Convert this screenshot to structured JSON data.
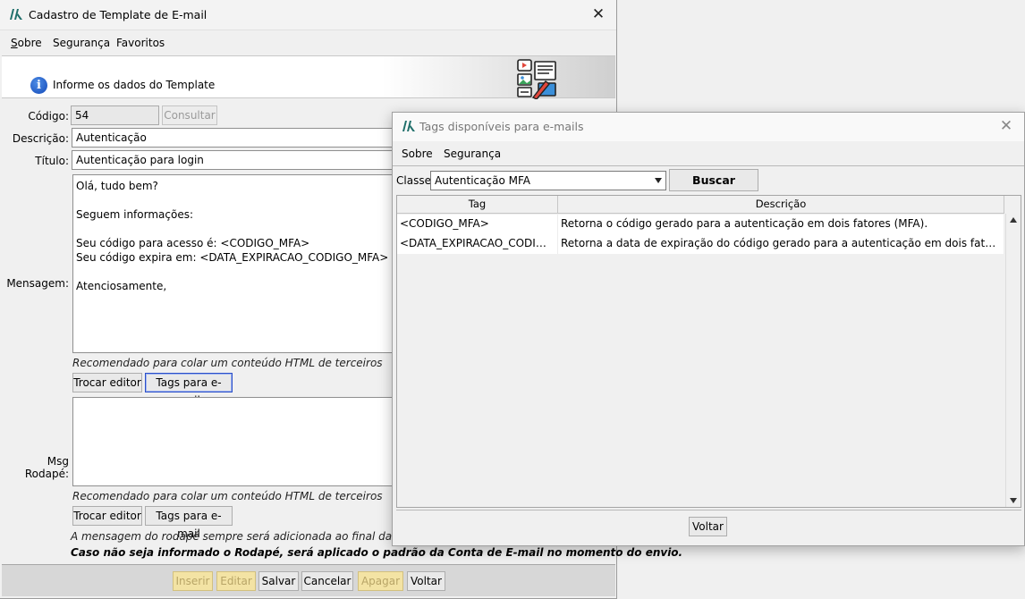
{
  "main_window": {
    "title": "Cadastro de Template de E-mail",
    "menu": [
      {
        "label": "Sobre",
        "mnemonic": "S",
        "rest": "obre"
      },
      {
        "label": "Segurança"
      },
      {
        "label": "Favoritos"
      }
    ],
    "header": {
      "text": "Informe os dados do Template"
    },
    "form": {
      "codigo_label": "Código:",
      "codigo_value": "54",
      "consultar_button": "Consultar",
      "descricao_label": "Descrição:",
      "descricao_value": "Autenticação",
      "titulo_label": "Título:",
      "titulo_value": "Autenticação para login",
      "mensagem_label": "Mensagem:",
      "mensagem_lines": [
        "Olá, tudo bem?",
        "",
        "Seguem informações:",
        "",
        "Seu código para acesso é: <CODIGO_MFA>",
        "Seu código expira em: <DATA_EXPIRACAO_CODIGO_MFA>",
        "",
        "Atenciosamente,"
      ],
      "hint_html": "Recomendado para colar um conteúdo HTML de terceiros",
      "trocar_editor_button": "Trocar editor",
      "tags_button": "Tags para e-mail",
      "rodape_label": "Msg Rodapé:",
      "rodape_note": "A mensagem do rodapé sempre será adicionada ao final das suas me",
      "rodape_note_bold": "Caso não seja informado o Rodapé, será aplicado o padrão da Conta de E-mail no momento do envio."
    },
    "bottom_buttons": {
      "inserir": "Inserir",
      "editar": "Editar",
      "salvar": "Salvar",
      "cancelar": "Cancelar",
      "apagar": "Apagar",
      "voltar": "Voltar"
    }
  },
  "tags_dialog": {
    "title": "Tags disponíveis para e-mails",
    "menu": [
      {
        "label": "Sobre"
      },
      {
        "label": "Segurança"
      }
    ],
    "classe_label": "Classe:",
    "classe_value": "Autenticação MFA",
    "buscar_button": "Buscar",
    "table": {
      "columns": [
        "Tag",
        "Descrição"
      ],
      "rows": [
        {
          "tag": "<CODIGO_MFA>",
          "descricao": "Retorna o código gerado para a autenticação em dois fatores (MFA)."
        },
        {
          "tag": "<DATA_EXPIRACAO_CODIGO_...",
          "descricao": "Retorna a data de expiração do código gerado para a autenticação em dois fatores (MFA)."
        }
      ]
    },
    "voltar_button": "Voltar"
  },
  "colors": {
    "accent_logo": "#1f6f6a",
    "disabled_yellow": "#f3e3a4",
    "info_blue": "#1c57c9"
  },
  "icons": [
    "app-logo-icon",
    "close-icon",
    "info-icon",
    "template-email-icon",
    "dropdown-arrow-icon",
    "scroll-up-icon",
    "scroll-down-icon"
  ]
}
